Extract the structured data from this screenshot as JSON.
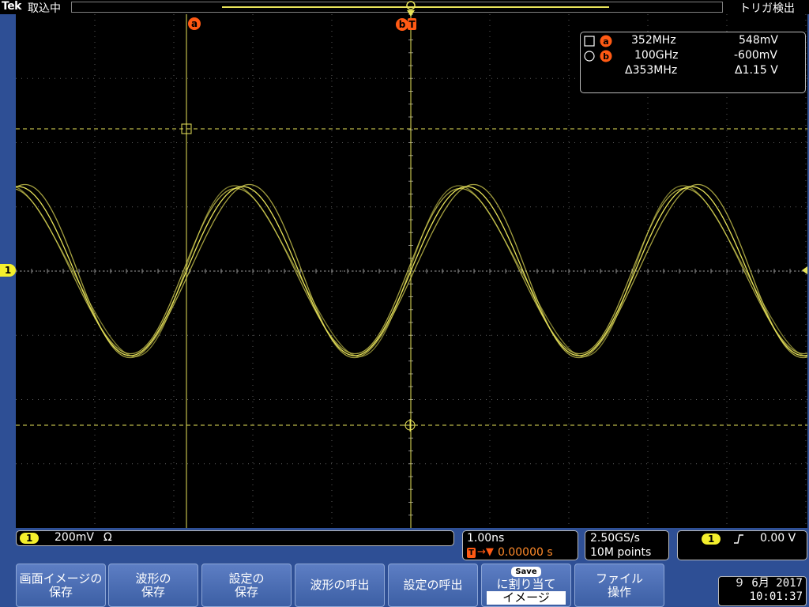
{
  "header": {
    "brand": "Tek",
    "acquisition_status": "取込中",
    "trigger_status": "トリガ検出"
  },
  "markers": {
    "cursor_a": "a",
    "cursor_b": "b",
    "trigger_letter": "T",
    "channel": "1"
  },
  "cursor_readout": {
    "a_freq": "352MHz",
    "a_value": "548mV",
    "b_freq": "100GHz",
    "b_value": "-600mV",
    "delta_freq": "Δ353MHz",
    "delta_value": "Δ1.15 V"
  },
  "status": {
    "channel_badge": "1",
    "vertical_scale": "200mV",
    "impedance": "Ω",
    "horizontal_scale": "1.00ns",
    "trigger_position": "0.00000 s",
    "sample_rate": "2.50GS/s",
    "record_length": "10M points",
    "trigger_source_badge": "1",
    "trigger_slope": "rising-edge-icon",
    "trigger_level": "0.00 V"
  },
  "menu": {
    "buttons": [
      {
        "line1": "画面イメージの",
        "line2": "保存"
      },
      {
        "line1": "波形の",
        "line2": "保存"
      },
      {
        "line1": "設定の",
        "line2": "保存"
      },
      {
        "line1": "波形の呼出",
        "line2": ""
      },
      {
        "line1": "設定の呼出",
        "line2": ""
      },
      {
        "line1": "に割り当て",
        "line2": "イメージ",
        "badge": "Save"
      },
      {
        "line1": "ファイル",
        "line2": "操作"
      }
    ]
  },
  "datetime": {
    "date": "９ 6月  2017",
    "time": "10:01:37"
  },
  "colors": {
    "trace": "#e8e35a",
    "marker": "#ff5a14",
    "background": "#2e4f95"
  }
}
